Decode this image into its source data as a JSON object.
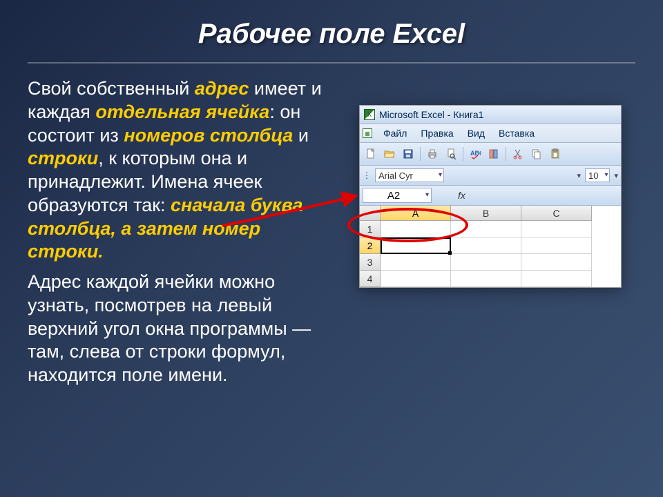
{
  "slide": {
    "title": "Рабочее поле Excel",
    "paragraph1": {
      "t1": "Свой собственный ",
      "hl1": "адрес",
      "t2": " имеет и каждая ",
      "hl2": "отдельная ячейка",
      "t3": ": он состоит из ",
      "hl3": "номеров столбца",
      "t4": " и ",
      "hl4": "строки",
      "t5": ", к которым она и принадлежит. Имена ячеек образуются так: ",
      "hl5": "сначала буква столбца, а затем номер строки."
    },
    "paragraph2": "Адрес каждой ячейки можно узнать, посмотрев на левый верхний угол окна программы — там, слева от строки формул, находится поле имени."
  },
  "excel": {
    "title": "Microsoft Excel - Книга1",
    "menu": {
      "file": "Файл",
      "edit": "Правка",
      "view": "Вид",
      "insert": "Вставка"
    },
    "font": "Arial Cyr",
    "size": "10",
    "namebox": "A2",
    "fx": "fx",
    "columns": [
      "A",
      "B",
      "C"
    ],
    "rows": [
      "1",
      "2",
      "3",
      "4"
    ],
    "active_row": "2",
    "active_col": "A"
  }
}
